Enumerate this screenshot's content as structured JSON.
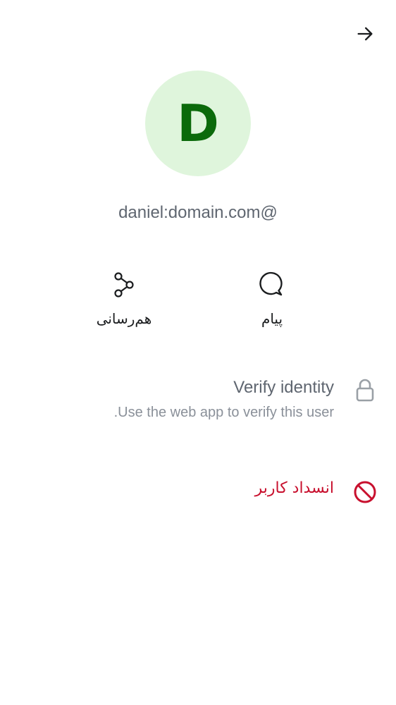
{
  "header": {
    "back_icon": "arrow-right-icon"
  },
  "profile": {
    "avatar_letter": "D",
    "avatar_bg": "#dff5dc",
    "avatar_fg": "#0b6a0b",
    "user_id": "@daniel:domain.com"
  },
  "actions": [
    {
      "icon": "share-icon",
      "label": "هم‌رسانی"
    },
    {
      "icon": "message-bubble-icon",
      "label": "پیام"
    }
  ],
  "verify": {
    "icon": "lock-icon",
    "title": "Verify identity",
    "description": "Use the web app to verify this user."
  },
  "block": {
    "icon": "block-icon",
    "label": "انسداد کاربر",
    "color": "#c8102e"
  }
}
